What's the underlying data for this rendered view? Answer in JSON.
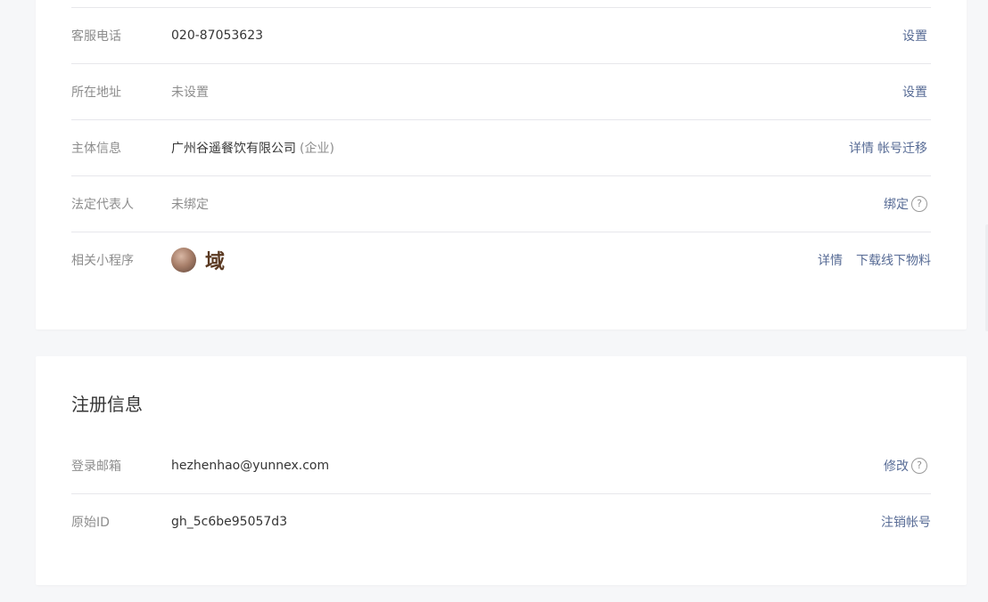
{
  "info_rows": [
    {
      "label": "客服电话",
      "value": "020-87053623",
      "actions": [
        "设置"
      ]
    },
    {
      "label": "所在地址",
      "value": "未设置",
      "actions": [
        "设置"
      ]
    },
    {
      "label": "主体信息",
      "value": "广州谷遥餐饮有限公司",
      "note": "(企业)",
      "actions": [
        "详情",
        "帐号迁移"
      ]
    },
    {
      "label": "法定代表人",
      "value": "未绑定",
      "actions": [
        "绑定"
      ],
      "help": "?"
    },
    {
      "label": "相关小程序",
      "app_glyph": "域",
      "actions": [
        "详情",
        "下载线下物料"
      ]
    }
  ],
  "registration": {
    "title": "注册信息",
    "rows": [
      {
        "label": "登录邮箱",
        "value": "hezhenhao@yunnex.com",
        "actions": [
          "修改"
        ],
        "help": "?"
      },
      {
        "label": "原始ID",
        "value": "gh_5c6be95057d3",
        "actions": [
          "注销帐号"
        ]
      }
    ]
  },
  "colors": {
    "link": "#576b95",
    "label": "#8d8d8d",
    "text": "#353535",
    "background": "#f6f7f9",
    "divider": "#e7e7eb"
  },
  "icons": {
    "help": "question-circle-icon",
    "avatar": "mini-program-avatar"
  }
}
